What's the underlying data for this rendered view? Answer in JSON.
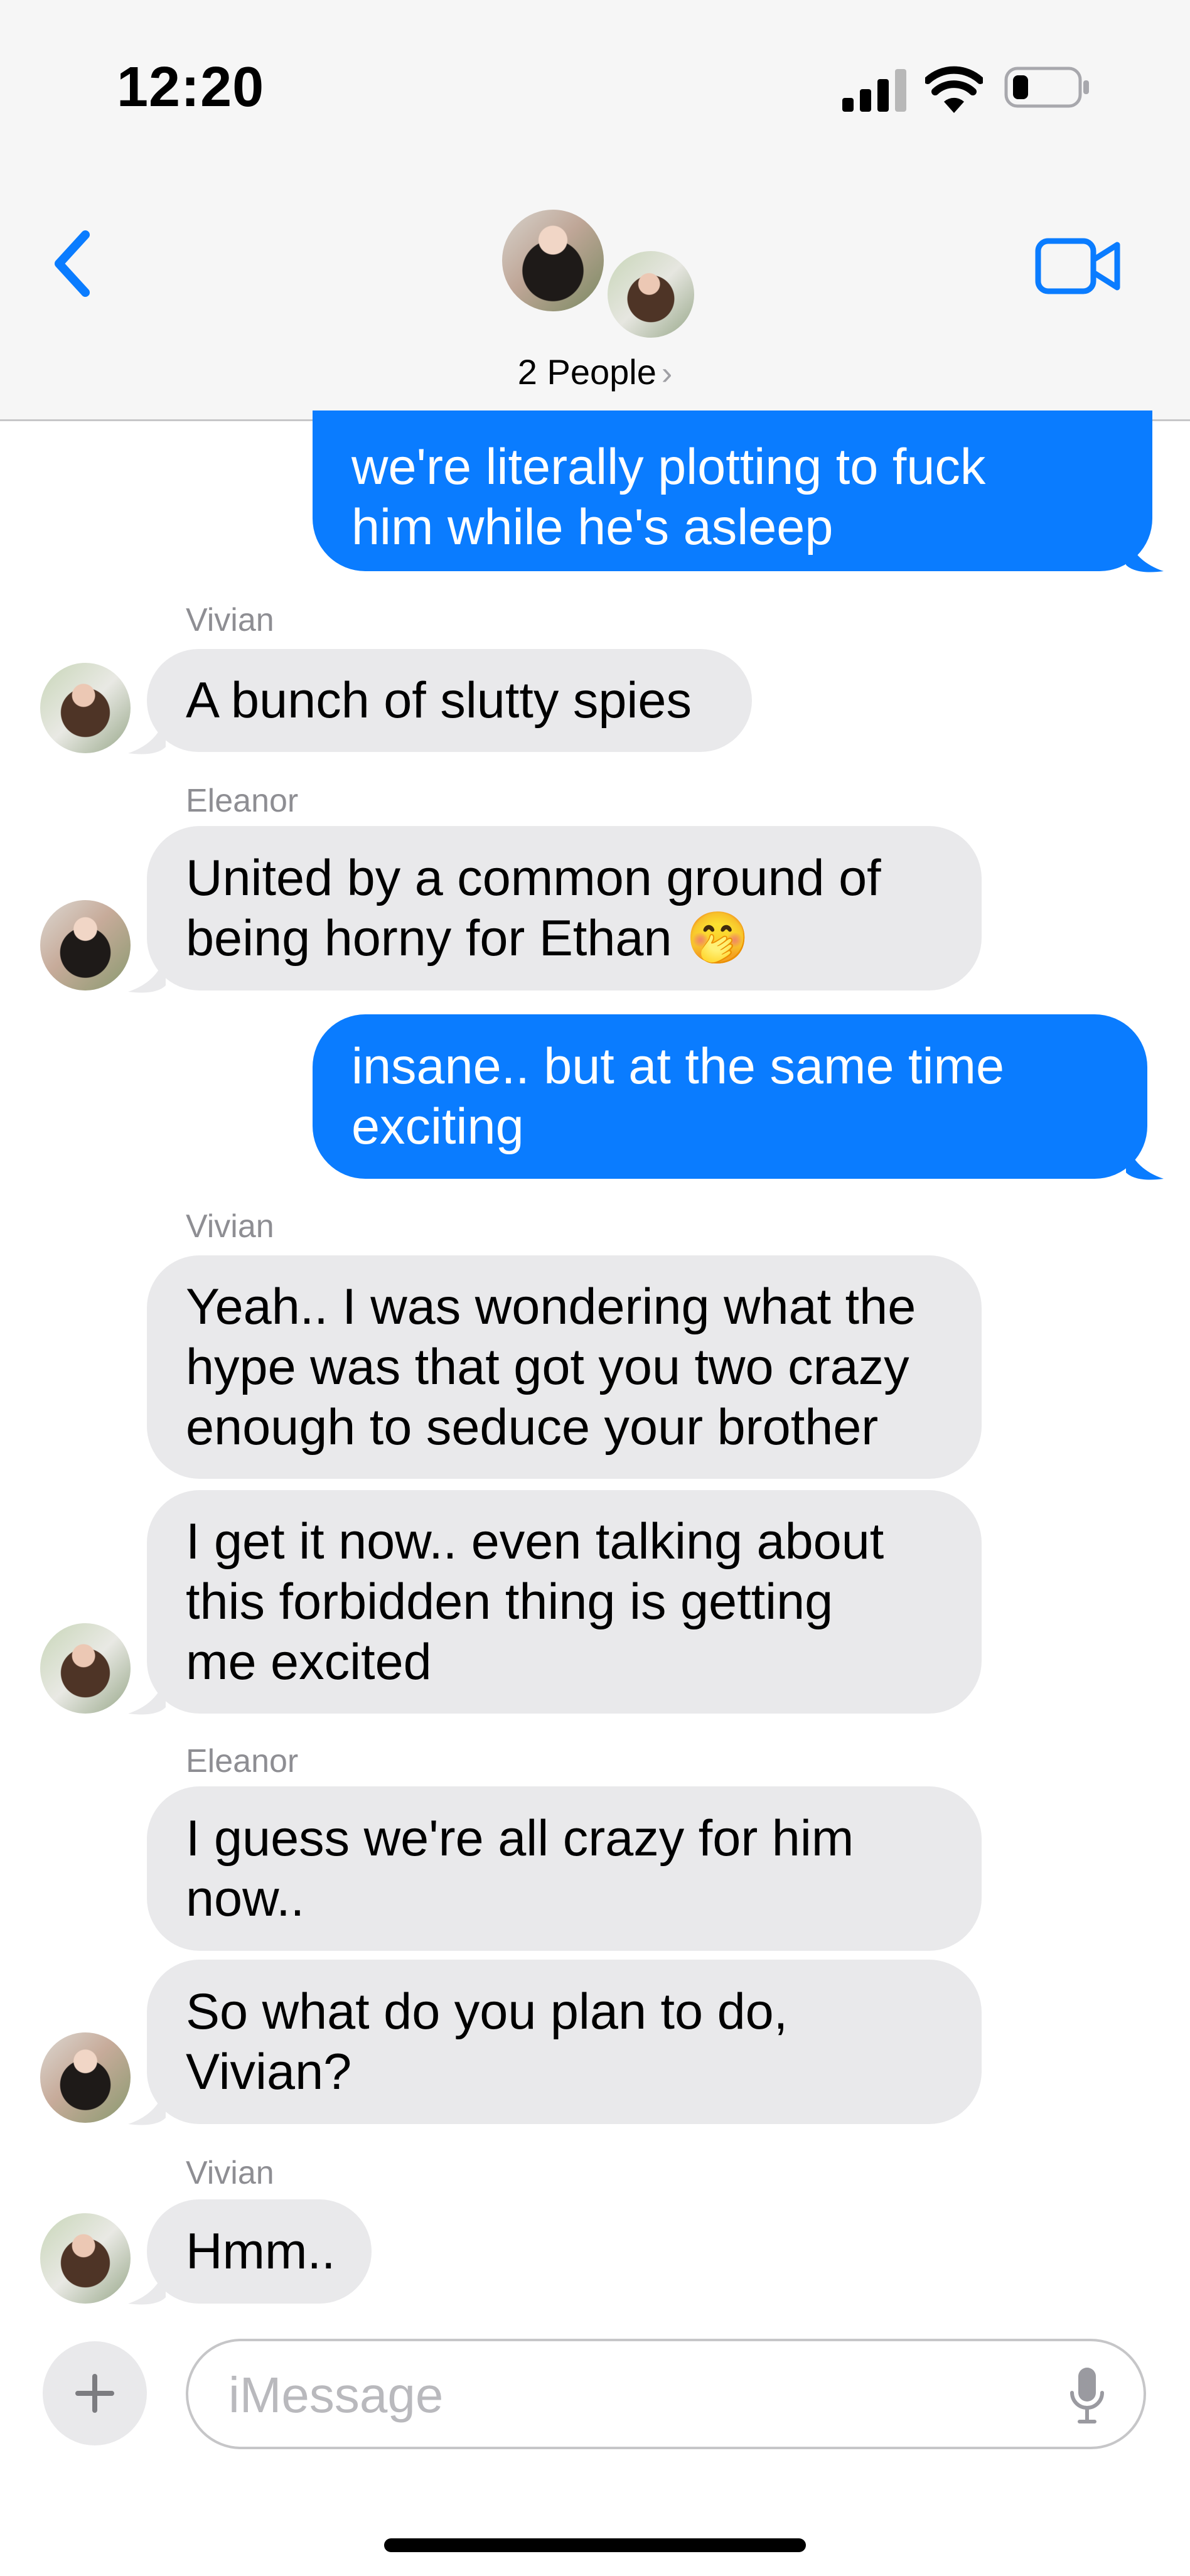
{
  "status_bar": {
    "time": "12:20"
  },
  "header": {
    "participants_label": "2 People",
    "chevron": "›"
  },
  "messages": [
    {
      "side": "out",
      "text": "we're literally plotting to fuck\nhim while he's asleep"
    },
    {
      "side": "in",
      "sender": "Vivian",
      "text": "A bunch of slutty spies"
    },
    {
      "side": "in",
      "sender": "Eleanor",
      "text": "United by a common ground of\nbeing horny for Ethan 🤭"
    },
    {
      "side": "out",
      "text": "insane.. but at the same time\nexciting"
    },
    {
      "side": "in",
      "sender": "Vivian",
      "text": "Yeah.. I was wondering what the\nhype was that got you two crazy\nenough to seduce your brother"
    },
    {
      "side": "in",
      "text": "I get it now.. even talking about\nthis forbidden thing is getting\nme excited"
    },
    {
      "side": "in",
      "sender": "Eleanor",
      "text": "I guess we're all crazy for him\nnow.."
    },
    {
      "side": "in",
      "text": "So what do you plan to do,\nVivian?"
    },
    {
      "side": "in",
      "sender": "Vivian",
      "text": "Hmm.."
    }
  ],
  "composer": {
    "placeholder": "iMessage"
  },
  "colors": {
    "outgoing": "#0a7cff",
    "incoming": "#e9e9eb",
    "accent": "#0a7cff"
  }
}
